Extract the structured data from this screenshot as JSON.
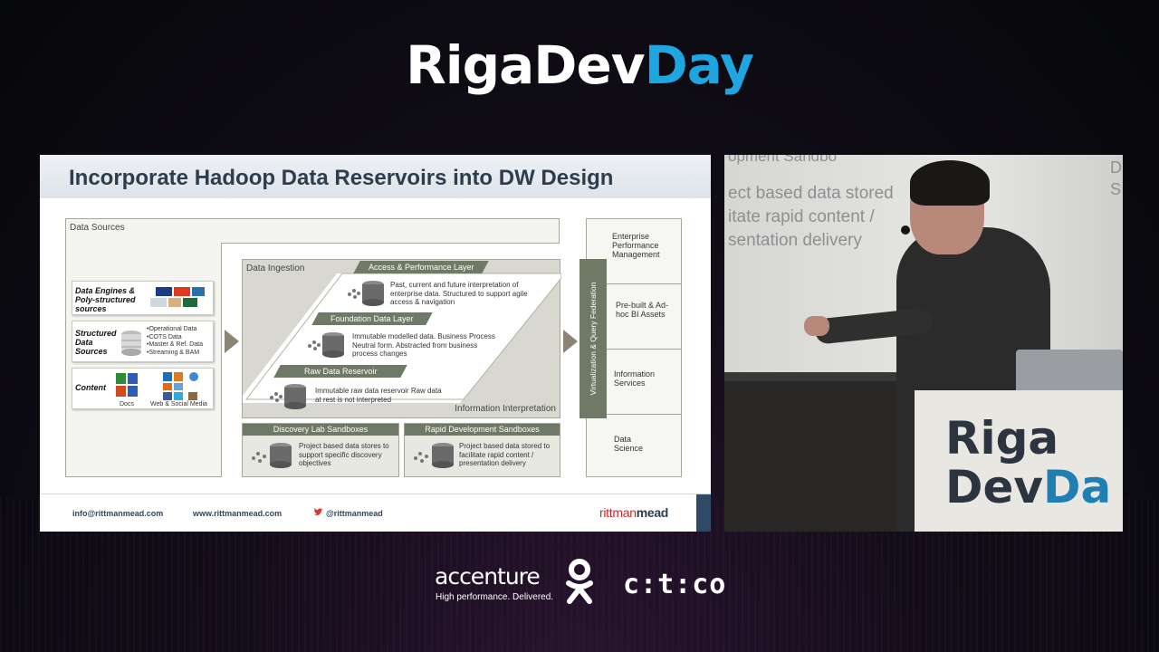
{
  "event": {
    "name_part1": "Riga",
    "name_part2": "Dev",
    "name_part3": "Day"
  },
  "slide": {
    "title": "Incorporate Hadoop Data Reservoirs into DW Design",
    "data_sources_label": "Data Sources",
    "sources": [
      {
        "title": "Data Engines & Poly-structured sources",
        "items": []
      },
      {
        "title": "Structured Data Sources",
        "items": [
          "•Operational Data",
          "•COTS Data",
          "•Master & Ref. Data",
          "•Streaming & BAM"
        ]
      },
      {
        "title": "Content",
        "items": [],
        "captions": [
          "Docs",
          "Web & Social Media"
        ]
      }
    ],
    "ingestion": {
      "label": "Data Ingestion",
      "sublabel": "Information Interpretation",
      "layers": [
        {
          "name": "Access & Performance Layer",
          "text": "Past, current and future interpretation of enterprise data. Structured to support agile access & navigation"
        },
        {
          "name": "Foundation Data Layer",
          "text": "Immutable modelled data. Business Process Neutral form. Abstracted from business process changes"
        },
        {
          "name": "Raw Data Reservoir",
          "text": "Immutable raw data reservoir Raw data at rest is not interpreted"
        }
      ]
    },
    "sandboxes": [
      {
        "name": "Discovery Lab Sandboxes",
        "text": "Project based data stores to support specific discovery objectives"
      },
      {
        "name": "Rapid Development Sandboxes",
        "text": "Project based data stored to facilitate rapid content / presentation delivery"
      }
    ],
    "virtualization": "Virtualization & Query Federation",
    "outputs": [
      "Enterprise Performance Management",
      "Pre-built & Ad-hoc BI Assets",
      "Information Services",
      "Data Science"
    ],
    "footer": {
      "email": "info@rittmanmead.com",
      "website": "www.rittmanmead.com",
      "twitter": "@rittmanmead",
      "brand_part1": "rittman",
      "brand_part2": "mead"
    }
  },
  "video": {
    "projection_lines": [
      "opment Sandbo",
      "ect based data stored",
      "itate rapid content /",
      "sentation delivery"
    ],
    "projection_right": [
      "D",
      "S"
    ],
    "podium_line1": "Riga",
    "podium_line2a": "Dev",
    "podium_line2b": "Da"
  },
  "sponsors": {
    "accenture_name": "accenture",
    "accenture_tagline": "High performance. Delivered.",
    "ok_icon": "odnoklassniki-icon",
    "citco": "c:t:co"
  },
  "colors": {
    "accent_blue": "#1fa6e0",
    "layer_green": "#6f7a66",
    "slide_title": "#2e3d4d",
    "brand_red": "#cc2a2a"
  }
}
